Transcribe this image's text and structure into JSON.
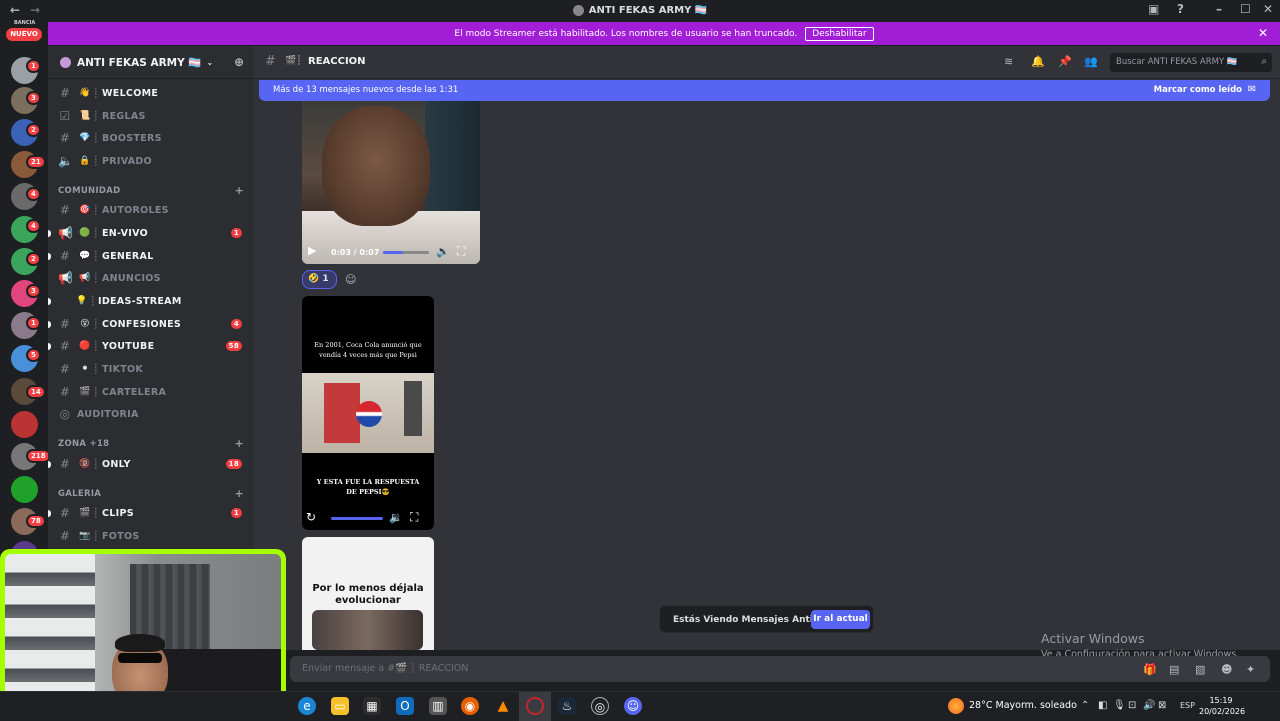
{
  "window": {
    "title": "ANTI FEKAS ARMY 🏳️‍⚧️"
  },
  "streamer_bar": {
    "text": "El modo Streamer está habilitado. Los nombres de usuario se han truncado.",
    "button": "Deshabilitar"
  },
  "guilds": {
    "new_label": "NUEVO",
    "top_label": "BANCIA",
    "badges": [
      "1",
      "3",
      "2",
      "21",
      "4",
      "4",
      "2",
      "3",
      "1",
      "5",
      "14",
      "218",
      "78"
    ]
  },
  "server": {
    "name": "ANTI FEKAS ARMY 🏳️‍⚧️"
  },
  "channels": [
    {
      "emoji": "👋",
      "name": "WELCOME",
      "badge": ""
    },
    {
      "emoji": "📜",
      "name": "REGLAS",
      "badge": ""
    },
    {
      "emoji": "💎",
      "name": "BOOSTERS",
      "badge": ""
    },
    {
      "emoji": "🔒",
      "name": "PRIVADO",
      "badge": ""
    },
    {
      "emoji": "🎯",
      "name": "AUTOROLES",
      "badge": ""
    },
    {
      "emoji": "🟢",
      "name": "EN-VIVO",
      "badge": "1"
    },
    {
      "emoji": "💬",
      "name": "GENERAL",
      "badge": ""
    },
    {
      "emoji": "📢",
      "name": "ANUNCIOS",
      "badge": ""
    },
    {
      "emoji": "💡",
      "name": "IDEAS-STREAM",
      "badge": ""
    },
    {
      "emoji": "😵",
      "name": "CONFESIONES",
      "badge": "4"
    },
    {
      "emoji": "🔴",
      "name": "YOUTUBE",
      "badge": "58"
    },
    {
      "emoji": "⚫",
      "name": "TIKTOK",
      "badge": ""
    },
    {
      "emoji": "🎬",
      "name": "CARTELERA",
      "badge": ""
    },
    {
      "emoji": "",
      "name": "AUDITORIA",
      "badge": ""
    },
    {
      "emoji": "🔞",
      "name": "ONLY",
      "badge": "18"
    },
    {
      "emoji": "🎬",
      "name": "CLIPS",
      "badge": "1"
    },
    {
      "emoji": "📷",
      "name": "FOTOS",
      "badge": ""
    }
  ],
  "categories": [
    "COMUNIDAD",
    "ZONA +18",
    "GALERIA"
  ],
  "topbar": {
    "channel": "REACCION",
    "search_placeholder": "Buscar ANTI FEKAS ARMY 🏳️‍⚧️"
  },
  "new_messages_bar": {
    "text": "Más de 13 mensajes nuevos desde las 1:31",
    "action": "Marcar como leído"
  },
  "video1": {
    "time": "0:03 / 0:07",
    "progress": 0.43
  },
  "reaction": {
    "emoji": "🤣",
    "count": "1"
  },
  "video2": {
    "caption_top": "En 2001, Coca Cola anunció que vendía 4 veces más que Pepsi",
    "caption_bottom": "Y ESTA FUE LA RESPUESTA DE PEPSI😎"
  },
  "video3": {
    "text": "Por lo menos déjala evolucionar"
  },
  "old_messages": {
    "text": "Estás Viendo Mensajes Antiguos",
    "button": "Ir al actual"
  },
  "activation": {
    "title": "Activar Windows",
    "subtitle": "Ve a Configuración para activar Windows."
  },
  "composer": {
    "placeholder": "Enviar mensaje a #🎬 ┊ REACCION"
  },
  "tray": {
    "weather": "28°C  Mayorm. soleado",
    "lang": "ESP",
    "time": "15:19",
    "date": "20/02/2026"
  },
  "colors": {
    "blurple": "#5865f2",
    "streamer": "#a11ed6",
    "badge_red": "#f23f43",
    "webcam_frame": "#a6ff00"
  }
}
